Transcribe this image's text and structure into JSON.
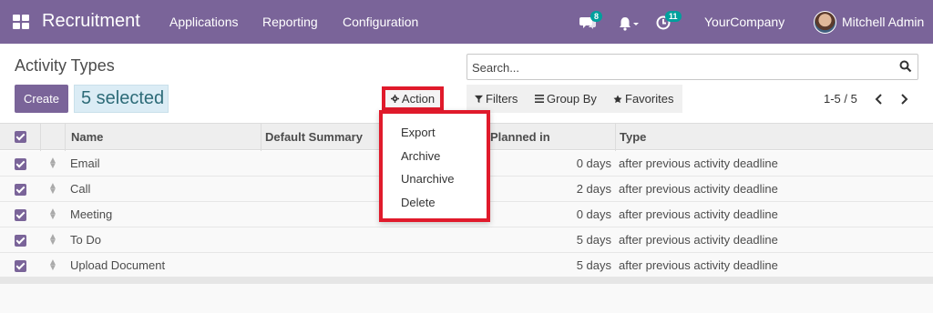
{
  "app": {
    "name": "Recruitment"
  },
  "nav": {
    "items": [
      "Applications",
      "Reporting",
      "Configuration"
    ]
  },
  "systray": {
    "messages_count": "8",
    "activities_count": "11",
    "company": "YourCompany",
    "user": "Mitchell Admin"
  },
  "control": {
    "title": "Activity Types",
    "create_label": "Create",
    "selected_label": "5 selected",
    "action_label": "Action",
    "search_placeholder": "Search...",
    "filters_label": "Filters",
    "groupby_label": "Group By",
    "favorites_label": "Favorites",
    "pager_value": "1-5 / 5"
  },
  "action_menu": {
    "items": [
      "Export",
      "Archive",
      "Unarchive",
      "Delete"
    ]
  },
  "table": {
    "columns": [
      "Name",
      "Default Summary",
      "Planned in",
      "Type"
    ],
    "rows": [
      {
        "name": "Email",
        "planned": "0 days",
        "type": "after previous activity deadline"
      },
      {
        "name": "Call",
        "planned": "2 days",
        "type": "after previous activity deadline"
      },
      {
        "name": "Meeting",
        "planned": "0 days",
        "type": "after previous activity deadline"
      },
      {
        "name": "To Do",
        "planned": "5 days",
        "type": "after previous activity deadline"
      },
      {
        "name": "Upload Document",
        "planned": "5 days",
        "type": "after previous activity deadline"
      }
    ]
  },
  "colors": {
    "brand": "#7a6499",
    "highlight": "#e01a2b",
    "badge": "#00a09d"
  }
}
